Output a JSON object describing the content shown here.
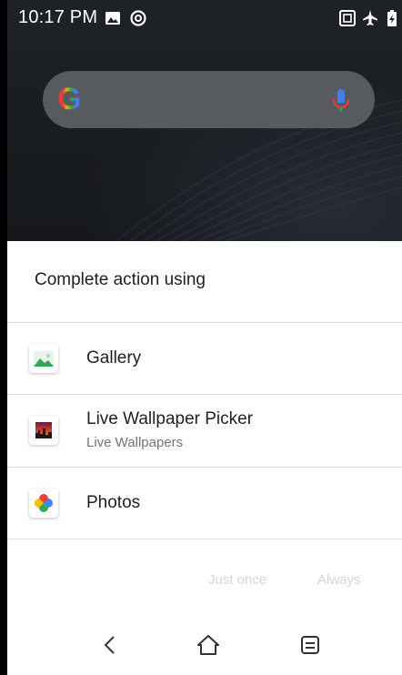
{
  "status_bar": {
    "time": "10:17 PM",
    "left_icons": [
      "image-icon",
      "at-sign-icon"
    ],
    "right_icons": [
      "nfc-icon",
      "airplane-mode-icon",
      "battery-charging-icon"
    ]
  },
  "search": {
    "logo": "G",
    "mic": "microphone-icon"
  },
  "dialog": {
    "title": "Complete action using",
    "apps": [
      {
        "label": "Gallery",
        "sublabel": "",
        "icon": "gallery-icon"
      },
      {
        "label": "Live Wallpaper Picker",
        "sublabel": "Live Wallpapers",
        "icon": "live-wallpaper-icon"
      },
      {
        "label": "Photos",
        "sublabel": "",
        "icon": "photos-pinwheel-icon"
      }
    ],
    "buttons": {
      "just_once": "Just once",
      "always": "Always"
    },
    "colors": {
      "button_disabled": "#d6d6d6",
      "title_text": "#212121",
      "sublabel_text": "#757575"
    }
  },
  "nav": {
    "back": "back-icon",
    "home": "home-icon",
    "recents": "recents-icon"
  }
}
